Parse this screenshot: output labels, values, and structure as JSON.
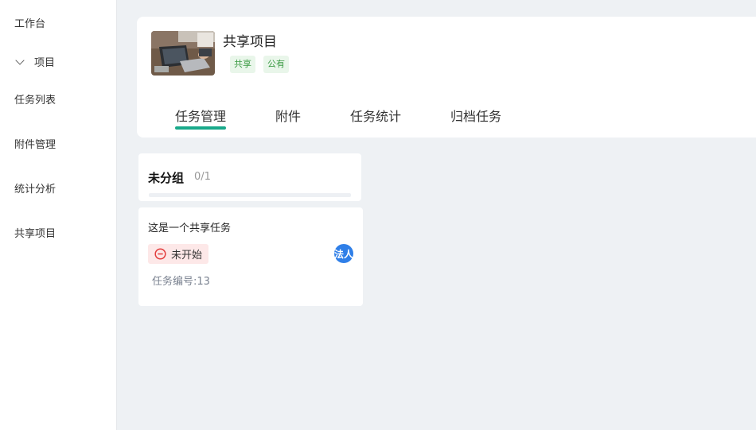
{
  "sidebar": {
    "items": [
      {
        "label": "工作台"
      },
      {
        "label": "项目"
      },
      {
        "label": "任务列表"
      },
      {
        "label": "附件管理"
      },
      {
        "label": "统计分析"
      },
      {
        "label": "共享项目"
      }
    ]
  },
  "project": {
    "title": "共享项目",
    "tags": [
      "共享",
      "公有"
    ]
  },
  "tabs": [
    {
      "label": "任务管理",
      "active": true
    },
    {
      "label": "附件"
    },
    {
      "label": "任务统计"
    },
    {
      "label": "归档任务"
    }
  ],
  "group": {
    "title": "未分组",
    "count": "0/1"
  },
  "task": {
    "title": "这是一个共享任务",
    "status": "未开始",
    "avatar": "法人",
    "number": "任务编号:13"
  },
  "colors": {
    "accent": "#19a98a",
    "tag_text": "#3a9a43",
    "status_bg": "#fde8e8",
    "status_icon": "#e23c3c",
    "avatar_bg": "#2f7fe8"
  }
}
